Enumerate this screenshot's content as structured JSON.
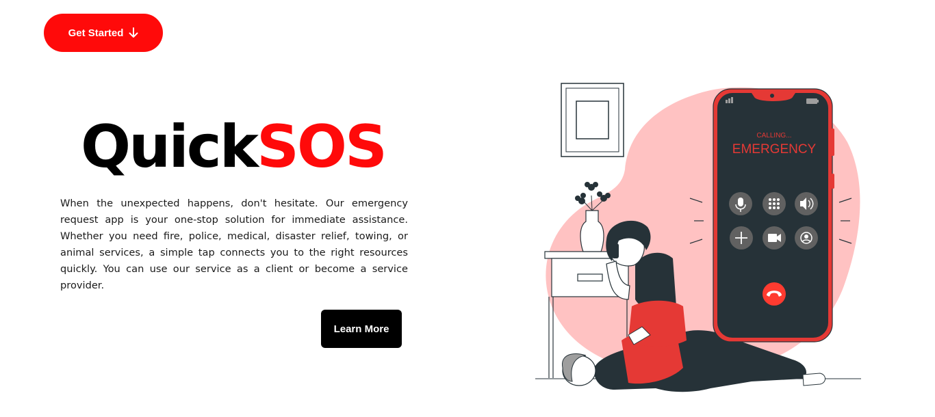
{
  "header": {
    "cta_label": "Get Started",
    "cta_icon": "arrow-down-icon"
  },
  "hero": {
    "brand_part1": "Quick",
    "brand_part2": "SOS",
    "description": "When the unexpected happens, don't hesitate. Our emergency request app is your one-stop solution for immediate assistance. Whether you need fire, police, medical, disaster relief, towing, or animal services, a simple tap connects you to the right resources quickly. You can use our service as a client or become a service provider.",
    "learn_more_label": "Learn More"
  },
  "illustration": {
    "phone_status": "CALLING...",
    "phone_title": "EMERGENCY",
    "phone_buttons": [
      "mic-icon",
      "keypad-icon",
      "speaker-icon",
      "add-call-icon",
      "video-icon",
      "contact-icon",
      "hang-up-icon"
    ]
  },
  "colors": {
    "accent": "#ff0a0a",
    "blob": "#ffc2c2",
    "phone_body": "#263238",
    "phone_frame": "#e53935",
    "dark_button": "#000000"
  }
}
